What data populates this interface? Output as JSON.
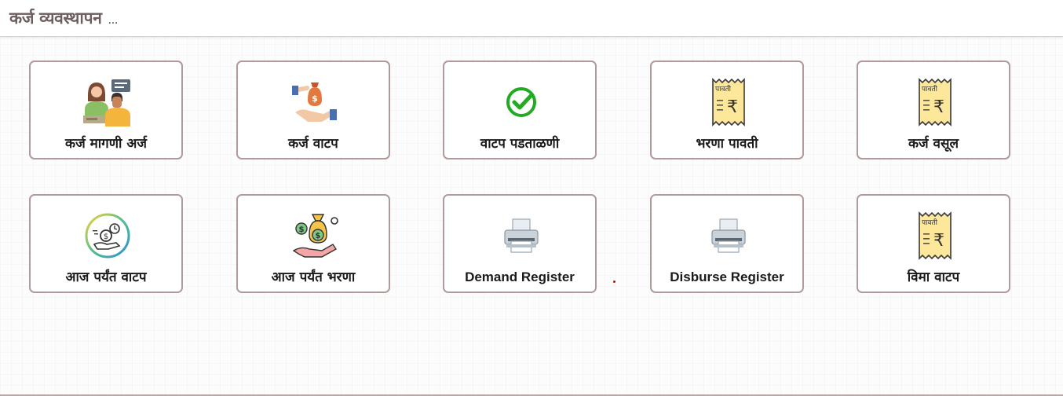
{
  "header": {
    "title": "कर्ज व्यवस्थापन",
    "ellipsis": "..."
  },
  "menu": {
    "items": [
      {
        "label": "कर्ज मागणी अर्ज",
        "icon": "loan-application-icon"
      },
      {
        "label": "कर्ज वाटप",
        "icon": "money-bag-hand-icon"
      },
      {
        "label": "वाटप पडताळणी",
        "icon": "check-circle-icon"
      },
      {
        "label": "भरणा पावती",
        "icon": "receipt-icon",
        "icon_text": "पावती"
      },
      {
        "label": "कर्ज वसूल",
        "icon": "receipt-icon",
        "icon_text": "पावती"
      },
      {
        "label": "आज पर्यंत वाटप",
        "icon": "money-time-circle-icon"
      },
      {
        "label": "आज पर्यंत भरणा",
        "icon": "money-bags-hand-icon"
      },
      {
        "label": "Demand Register",
        "icon": "printer-icon"
      },
      {
        "label": "Disburse Register",
        "icon": "printer-icon"
      },
      {
        "label": "विमा वाटप",
        "icon": "receipt-icon",
        "icon_text": "पावती"
      }
    ]
  },
  "colors": {
    "card_border": "#b09a9a",
    "title": "#6e5f5f",
    "check_green": "#22aa22",
    "receipt_yellow": "#fce79a"
  }
}
